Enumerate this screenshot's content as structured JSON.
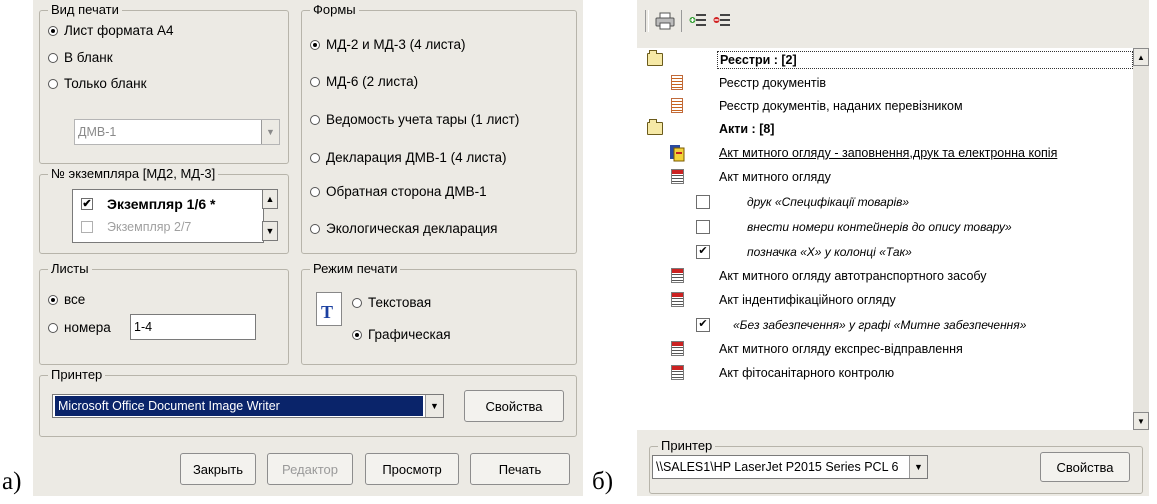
{
  "captions": {
    "a": "а)",
    "b": "б)"
  },
  "dialog_a": {
    "print_type": {
      "title": "Вид печати",
      "options": [
        "Лист формата А4",
        "В бланк",
        "Только бланк"
      ],
      "selected": 0,
      "blank_combo_value": "ДМВ-1"
    },
    "copy_number": {
      "title": "№ экземпляра [МД2, МД-3]",
      "items": [
        {
          "label": "Экземпляр 1/6 *",
          "checked": true
        },
        {
          "label": "Экземпляр 2/7",
          "checked": false
        }
      ]
    },
    "sheets": {
      "title": "Листы",
      "options": [
        "все",
        "номера"
      ],
      "selected": 0,
      "range_value": "1-4"
    },
    "forms": {
      "title": "Формы",
      "options": [
        "МД-2 и МД-3 (4 листа)",
        "МД-6 (2 листа)",
        "Ведомость учета тары (1 лист)",
        "Декларация ДМВ-1 (4 листа)",
        "Обратная сторона ДМВ-1",
        "Экологическая декларация"
      ],
      "selected": 0
    },
    "print_mode": {
      "title": "Режим печати",
      "options": [
        "Текстовая",
        "Графическая"
      ],
      "selected": 1,
      "icon_glyph": "T"
    },
    "printer": {
      "title": "Принтер",
      "value": "Microsoft Office Document Image Writer",
      "properties_label": "Свойства"
    },
    "buttons": {
      "close": "Закрыть",
      "editor": "Редактор",
      "preview": "Просмотр",
      "print": "Печать"
    }
  },
  "dialog_b": {
    "rows": [
      {
        "type": "group",
        "icon": "folder-icon",
        "label": "Реєстри : [2]"
      },
      {
        "type": "doc",
        "icon": "register-doc-icon",
        "label": "Реєстр документів"
      },
      {
        "type": "doc",
        "icon": "register-doc-icon",
        "label": "Реєстр документів, наданих перевізником"
      },
      {
        "type": "group",
        "icon": "folder-icon",
        "label": "Акти : [8]"
      },
      {
        "type": "link",
        "icon": "act-package-icon",
        "label": "Акт митного огляду - заповнення,друк та електронна копія"
      },
      {
        "type": "doc",
        "icon": "act-doc-icon",
        "label": "Акт митного огляду"
      },
      {
        "type": "option",
        "checked": false,
        "label": "друк «Специфікації товарів»"
      },
      {
        "type": "option",
        "checked": false,
        "label": "внести номери контейнерів до опису товару»"
      },
      {
        "type": "option",
        "checked": true,
        "label": "позначка «Х» у колонці «Так»"
      },
      {
        "type": "doc",
        "icon": "act-doc-icon",
        "label": "Акт митного огляду автотранспортного засобу"
      },
      {
        "type": "doc",
        "icon": "act-doc-icon",
        "label": "Акт індентифікаційного огляду"
      },
      {
        "type": "option",
        "checked": true,
        "label": "«Без забезпечення» у графі «Митне забезпечення»"
      },
      {
        "type": "doc",
        "icon": "act-doc-icon",
        "label": "Акт митного огляду експрес-відправлення"
      },
      {
        "type": "doc",
        "icon": "act-doc-icon",
        "label": "Акт фітосанітарного контролю"
      }
    ],
    "printer": {
      "title": "Принтер",
      "value": "\\\\SALES1\\HP LaserJet P2015 Series PCL 6",
      "properties_label": "Свойства"
    },
    "toolbar": [
      "print-icon",
      "expand-icon",
      "collapse-icon"
    ]
  }
}
